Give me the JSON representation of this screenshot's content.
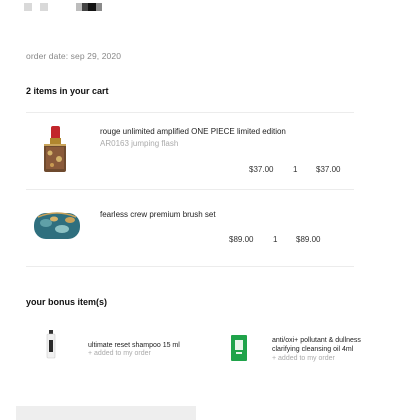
{
  "order": {
    "date_label": "order date: sep 29, 2020"
  },
  "cart": {
    "title": "2 items in your cart",
    "items": [
      {
        "name": "rouge unlimited amplified ONE PIECE limited edition",
        "variant": "AR0163 jumping flash",
        "price": "$37.00",
        "quantity": "1",
        "total": "$37.00",
        "icon": "lipstick-icon"
      },
      {
        "name": "fearless crew premium brush set",
        "variant": "",
        "price": "$89.00",
        "quantity": "1",
        "total": "$89.00",
        "icon": "brush-pouch-icon"
      }
    ]
  },
  "bonus": {
    "title": "your bonus item(s)",
    "items": [
      {
        "name_line1": "ultimate reset shampoo 15 ml",
        "name_line2": "",
        "note": "+ added to my order",
        "icon": "shampoo-tube-icon"
      },
      {
        "name_line1": "anti/oxi+ pollutant & dullness",
        "name_line2": "clarifying cleansing oil 4ml",
        "note": "+ added to my order",
        "icon": "cleansing-oil-sample-icon"
      }
    ]
  },
  "colors": {
    "lipstick_case": "#8a5a3a",
    "lipstick_red": "#c2262b",
    "pouch_teal": "#2f6f7e",
    "green_sample": "#1fa34a"
  }
}
